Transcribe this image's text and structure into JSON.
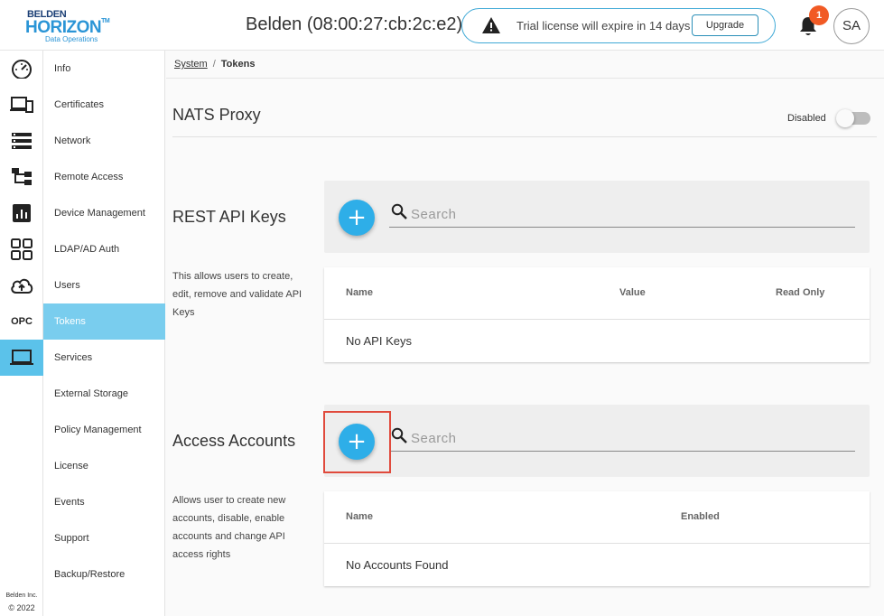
{
  "header": {
    "logo_line1": "BELDEN",
    "logo_line2": "HORIZON",
    "logo_tm": "TM",
    "logo_line3": "Data Operations",
    "device_title": "Belden (08:00:27:cb:2c:e2)",
    "trial_message": "Trial license will expire in 14 days",
    "upgrade_label": "Upgrade",
    "notification_count": "1",
    "avatar_initials": "SA"
  },
  "rail": {
    "opc_label": "OPC",
    "footer_line1": "Belden Inc.",
    "footer_line2": "© 2022",
    "active_color": "#5bc2ea"
  },
  "subnav": {
    "items": [
      {
        "label": "Info"
      },
      {
        "label": "Certificates"
      },
      {
        "label": "Network"
      },
      {
        "label": "Remote Access"
      },
      {
        "label": "Device Management"
      },
      {
        "label": "LDAP/AD Auth"
      },
      {
        "label": "Users"
      },
      {
        "label": "Tokens"
      },
      {
        "label": "Services"
      },
      {
        "label": "External Storage"
      },
      {
        "label": "Policy Management"
      },
      {
        "label": "License"
      },
      {
        "label": "Events"
      },
      {
        "label": "Support"
      },
      {
        "label": "Backup/Restore"
      }
    ],
    "active_index": 7
  },
  "breadcrumb": {
    "parent": "System",
    "separator": "/",
    "current": "Tokens"
  },
  "nats": {
    "title": "NATS Proxy",
    "toggle_label": "Disabled",
    "toggle_on": false
  },
  "rest_api_keys": {
    "title": "REST API Keys",
    "description": "This allows users to create, edit, remove and validate API Keys",
    "add_symbol": "+",
    "search_placeholder": "Search",
    "columns": [
      "Name",
      "Value",
      "Read Only"
    ],
    "empty_text": "No API Keys"
  },
  "access_accounts": {
    "title": "Access Accounts",
    "description": "Allows user to create new accounts, disable, enable accounts and change API access rights",
    "add_symbol": "+",
    "search_placeholder": "Search",
    "columns": [
      "Name",
      "Enabled"
    ],
    "empty_text": "No Accounts Found"
  },
  "colors": {
    "accent": "#2eaee8",
    "nav_active": "#79cdee",
    "badge": "#f15a24",
    "highlight": "#e04a3c"
  }
}
